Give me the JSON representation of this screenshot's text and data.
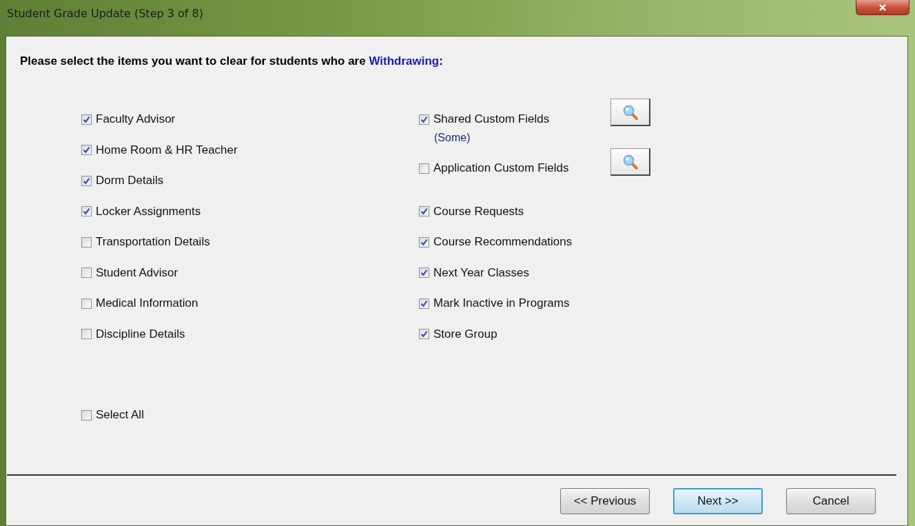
{
  "window": {
    "title": "Student Grade Update (Step 3 of 8)"
  },
  "prompt": {
    "text": "Please select the items you want to clear for students who are",
    "emphasis": "Withdrawing",
    "end": ":"
  },
  "left_items": [
    {
      "label": "Faculty Advisor",
      "checked": true
    },
    {
      "label": "Home Room & HR Teacher",
      "checked": true
    },
    {
      "label": "Dorm Details",
      "checked": true
    },
    {
      "label": "Locker Assignments",
      "checked": true
    },
    {
      "label": "Transportation Details",
      "checked": false
    },
    {
      "label": "Student Advisor",
      "checked": false
    },
    {
      "label": "Medical Information",
      "checked": false
    },
    {
      "label": "Discipline Details",
      "checked": false
    }
  ],
  "select_all": {
    "label": "Select All",
    "checked": false
  },
  "custom_fields": [
    {
      "label": "Shared Custom Fields",
      "checked": true,
      "note": "(Some)"
    },
    {
      "label": "Application Custom Fields",
      "checked": false
    }
  ],
  "right_items": [
    {
      "label": "Course Requests",
      "checked": true
    },
    {
      "label": "Course Recommendations",
      "checked": true
    },
    {
      "label": "Next Year Classes",
      "checked": true
    },
    {
      "label": "Mark Inactive in Programs",
      "checked": true
    },
    {
      "label": "Store Group",
      "checked": true
    }
  ],
  "buttons": [
    {
      "label": "<< Previous",
      "kind": "normal"
    },
    {
      "label": "Next >>",
      "kind": "default"
    },
    {
      "label": "Cancel",
      "kind": "normal"
    }
  ]
}
